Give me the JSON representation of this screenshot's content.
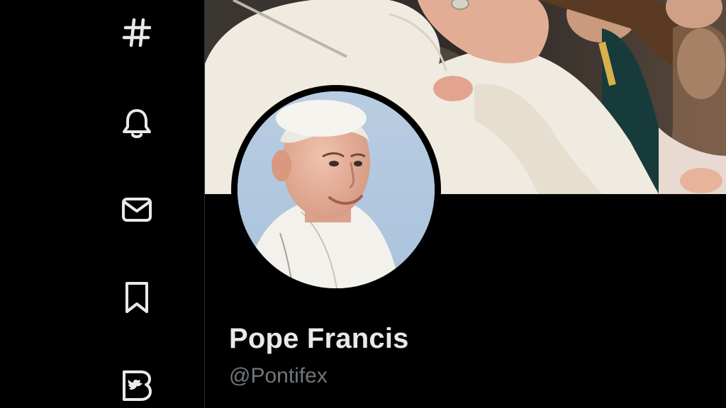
{
  "sidebar": {
    "items": [
      {
        "id": "explore",
        "icon": "hashtag-icon"
      },
      {
        "id": "notifications",
        "icon": "bell-icon"
      },
      {
        "id": "messages",
        "icon": "envelope-icon"
      },
      {
        "id": "bookmarks",
        "icon": "bookmark-icon"
      },
      {
        "id": "twitter-blue",
        "icon": "twitter-blue-icon"
      }
    ]
  },
  "profile": {
    "display_name": "Pope Francis",
    "handle": "@Pontifex"
  },
  "colors": {
    "background": "#000000",
    "primary_text": "#e7e9ea",
    "secondary_text": "#71767b",
    "divider": "#2f3336"
  }
}
